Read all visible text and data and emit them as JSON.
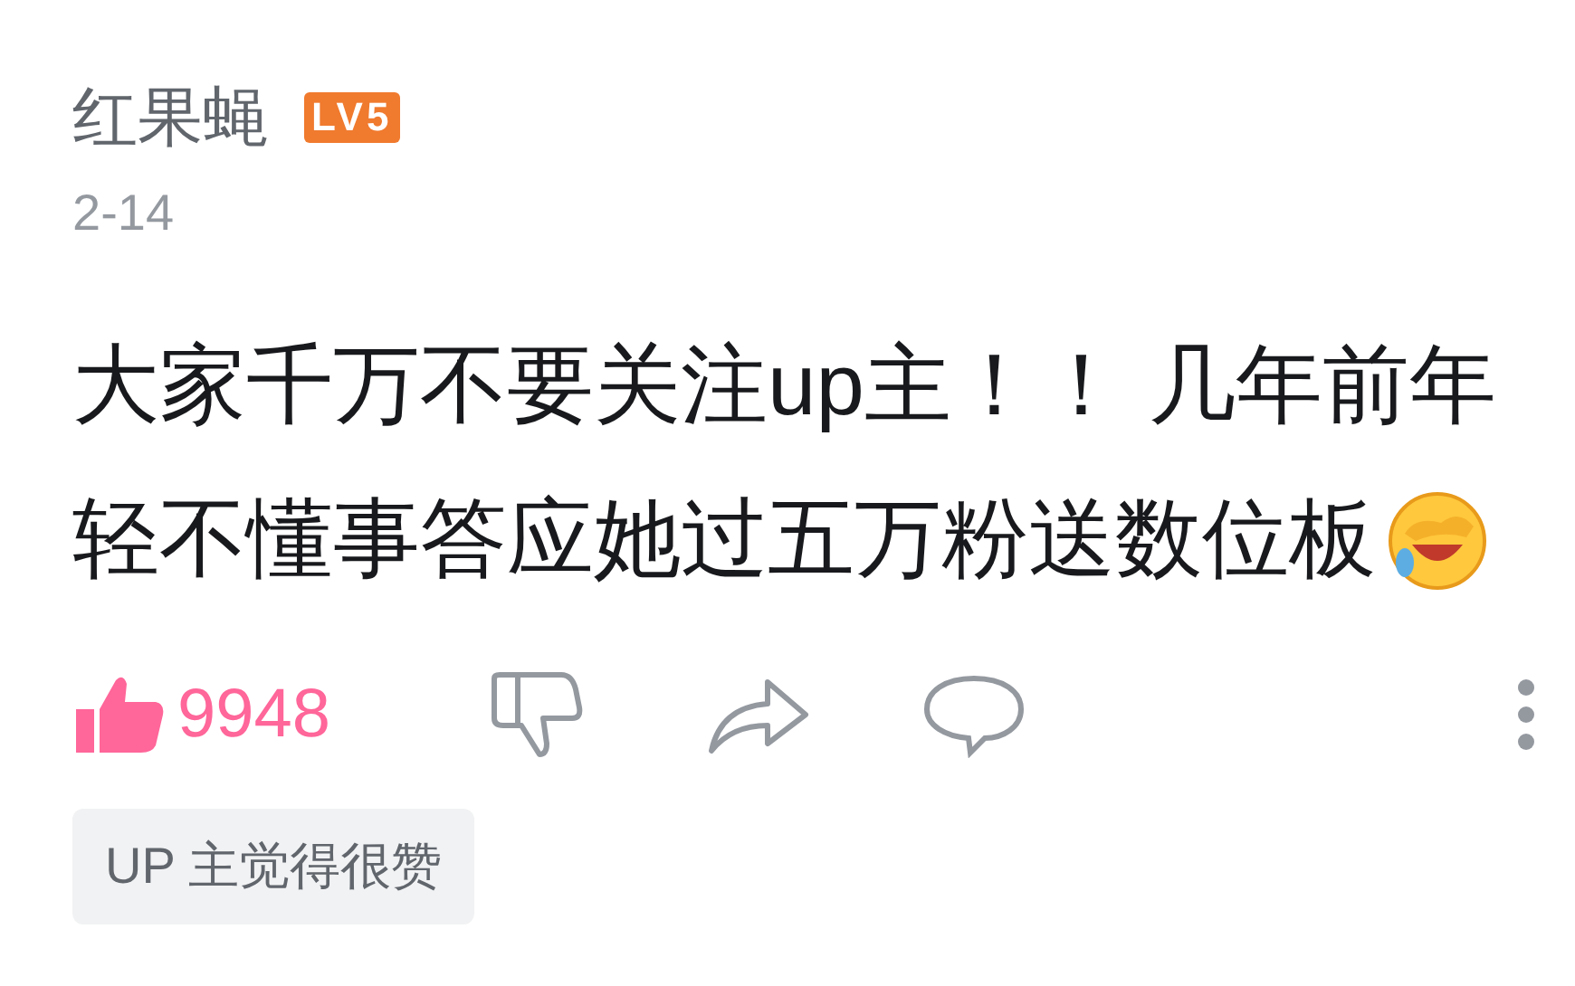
{
  "comment": {
    "username": "红果蝇",
    "level_badge": "LV5",
    "date": "2-14",
    "text_lines": [
      "大家千万不要关注up主！！ 几年前年",
      "轻不懂事答应她过五万粉送数位板"
    ],
    "like": {
      "count": "9948",
      "liked": true
    },
    "tag": "UP 主觉得很赞"
  }
}
